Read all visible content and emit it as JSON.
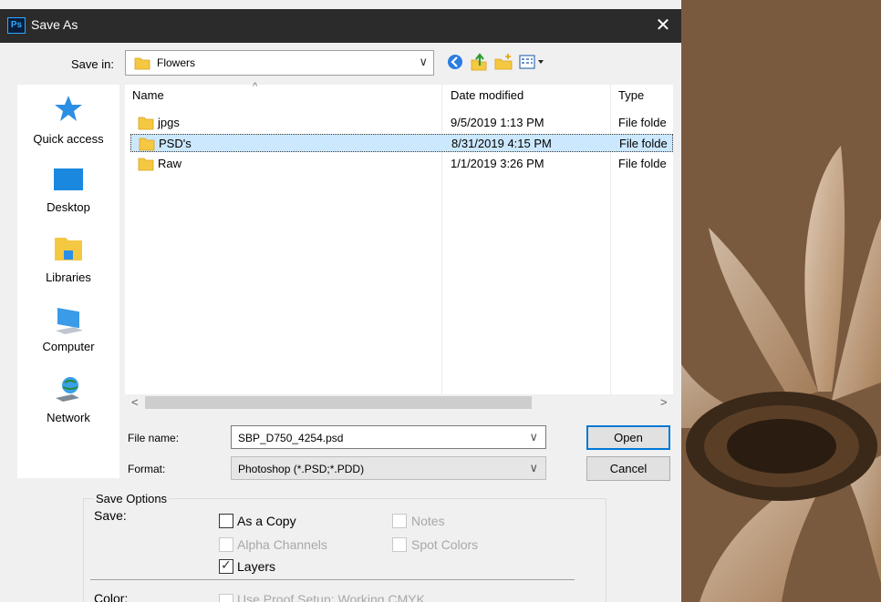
{
  "window": {
    "title": "Save As",
    "app_icon": "Ps",
    "close_glyph": "✕"
  },
  "save_in": {
    "label": "Save in:",
    "value": "Flowers"
  },
  "toolbar": {
    "back_icon": "back-icon",
    "up_icon": "up-folder-icon",
    "new_folder_icon": "new-folder-icon",
    "view_icon": "view-menu-icon"
  },
  "places": [
    {
      "label": "Quick access",
      "icon": "star-icon"
    },
    {
      "label": "Desktop",
      "icon": "desktop-icon"
    },
    {
      "label": "Libraries",
      "icon": "libraries-icon"
    },
    {
      "label": "Computer",
      "icon": "computer-icon"
    },
    {
      "label": "Network",
      "icon": "network-icon"
    }
  ],
  "columns": {
    "name": "Name",
    "date": "Date modified",
    "type": "Type"
  },
  "files": [
    {
      "name": "jpgs",
      "date": "9/5/2019 1:13 PM",
      "type": "File folde",
      "selected": false
    },
    {
      "name": "PSD's",
      "date": "8/31/2019 4:15 PM",
      "type": "File folde",
      "selected": true
    },
    {
      "name": "Raw",
      "date": "1/1/2019 3:26 PM",
      "type": "File folde",
      "selected": false
    }
  ],
  "scroll": {
    "left": "<",
    "right": ">"
  },
  "file_name": {
    "label": "File name:",
    "value": "SBP_D750_4254.psd"
  },
  "format": {
    "label": "Format:",
    "value": "Photoshop (*.PSD;*.PDD)"
  },
  "buttons": {
    "open": "Open",
    "cancel": "Cancel"
  },
  "save_options": {
    "legend": "Save Options",
    "save_label": "Save:",
    "as_a_copy": {
      "label": "As a Copy",
      "checked": false,
      "enabled": true
    },
    "notes": {
      "label": "Notes",
      "checked": false,
      "enabled": false
    },
    "alpha_channels": {
      "label": "Alpha Channels",
      "checked": false,
      "enabled": false
    },
    "spot_colors": {
      "label": "Spot Colors",
      "checked": false,
      "enabled": false
    },
    "layers": {
      "label": "Layers",
      "checked": true,
      "enabled": true
    },
    "color_label": "Color:",
    "use_proof_setup": {
      "label": "Use Proof Setup:  Working CMYK",
      "checked": false,
      "enabled": false
    }
  },
  "colors": {
    "title_bar": "#2b2b2b",
    "selection": "#cce8ff",
    "accent": "#0078d7"
  }
}
